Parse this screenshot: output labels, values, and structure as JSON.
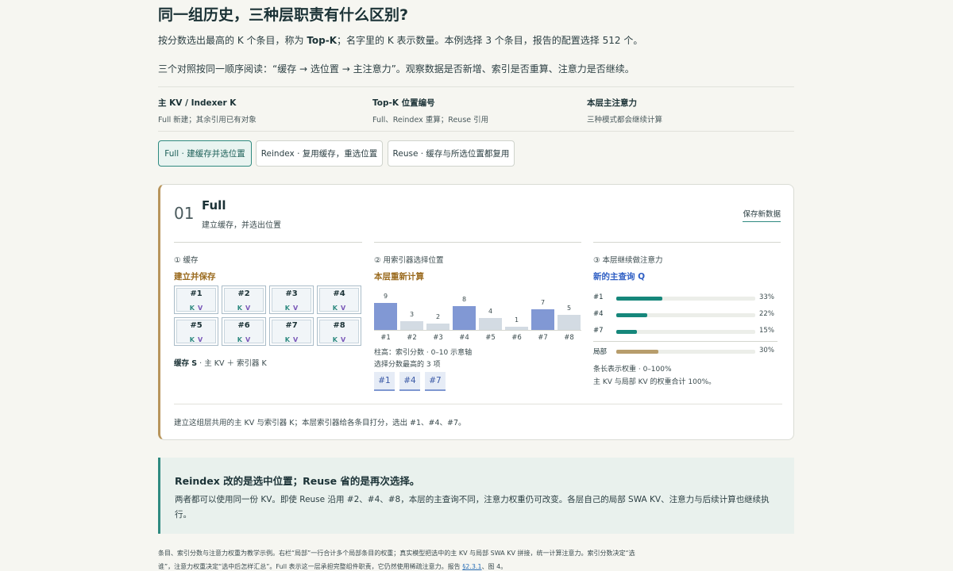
{
  "header": {
    "title": "同一组历史，三种层职责有什么区别?",
    "lead1_pre": "按分数选出最高的 K 个条目，称为 ",
    "lead1_bold": "Top-K",
    "lead1_post": "；名字里的 K 表示数量。本例选择 3 个条目，报告的配置选择 512 个。",
    "lead2": "三个对照按同一顺序阅读：“缓存 → 选位置 → 主注意力”。观察数据是否新增、索引是否重算、注意力是否继续。"
  },
  "legend": [
    {
      "title": "主 KV / Indexer K",
      "sub": "Full 新建；其余引用已有对象"
    },
    {
      "title": "Top-K 位置编号",
      "sub": "Full、Reindex 重算；Reuse 引用"
    },
    {
      "title": "本层主注意力",
      "sub": "三种模式都会继续计算"
    }
  ],
  "tabs": [
    {
      "label": "Full · 建缓存并选位置",
      "active": true
    },
    {
      "label": "Reindex · 复用缓存，重选位置",
      "active": false
    },
    {
      "label": "Reuse · 缓存与所选位置都复用",
      "active": false
    }
  ],
  "card": {
    "number": "01",
    "mode": "Full",
    "subtitle": "建立缓存，并选出位置",
    "save_link": "保存新数据",
    "col1": {
      "heading": "① 缓存",
      "title": "建立并保存",
      "title_color": "#9a6a1e",
      "cells": [
        {
          "id": "#1",
          "k": "K",
          "v": "V"
        },
        {
          "id": "#2",
          "k": "K",
          "v": "V"
        },
        {
          "id": "#3",
          "k": "K",
          "v": "V"
        },
        {
          "id": "#4",
          "k": "K",
          "v": "V"
        },
        {
          "id": "#5",
          "k": "K",
          "v": "V"
        },
        {
          "id": "#6",
          "k": "K",
          "v": "V"
        },
        {
          "id": "#7",
          "k": "K",
          "v": "V"
        },
        {
          "id": "#8",
          "k": "K",
          "v": "V"
        }
      ],
      "caption_bold": "缓存 S",
      "caption_rest": " · 主 KV ＋ 索引器 K"
    },
    "col2": {
      "heading": "② 用索引器选择位置",
      "title": "本层重新计算",
      "title_color": "#9a6a1e",
      "caption1": "柱高：索引分数 · 0–10 示意轴",
      "caption2": "选择分数最高的 3 项",
      "selected": [
        "#1",
        "#4",
        "#7"
      ]
    },
    "col3": {
      "heading": "③ 本层继续做注意力",
      "title": "新的主查询 Q",
      "title_color": "#2f5fc4",
      "caption1": "条长表示权重 · 0–100%",
      "caption2": "主 KV 与局部 KV 的权重合计 100%。"
    },
    "footer": "建立这组层共用的主 KV 与索引器 K；本层索引器给各条目打分，选出 #1、#4、#7。"
  },
  "chart_data": [
    {
      "type": "bar",
      "title": "本层重新计算",
      "categories": [
        "#1",
        "#2",
        "#3",
        "#4",
        "#5",
        "#6",
        "#7",
        "#8"
      ],
      "values": [
        9,
        3,
        2,
        8,
        4,
        1,
        7,
        5
      ],
      "ylim": [
        0,
        10
      ],
      "selected": [
        "#1",
        "#4",
        "#7"
      ],
      "colors": {
        "selected": "#8198d4",
        "other": "#d3dbe3"
      }
    },
    {
      "type": "bar",
      "title": "新的主查询 Q",
      "orientation": "horizontal",
      "categories": [
        "#1",
        "#4",
        "#7",
        "局部"
      ],
      "values": [
        33,
        22,
        15,
        30
      ],
      "value_labels": [
        "33%",
        "22%",
        "15%",
        "30%"
      ],
      "xlim": [
        0,
        100
      ],
      "colors": {
        "main": "#16877b",
        "local": "#b79d6c"
      }
    }
  ],
  "note": {
    "title": "Reindex 改的是选中位置；Reuse 省的是再次选择。",
    "body": "两者都可以使用同一份 KV。即使 Reuse 沿用 #2、#4、#8，本层的主查询不同，注意力权重仍可改变。各层自己的局部 SWA KV、注意力与后续计算也继续执行。"
  },
  "footnote": {
    "text": "条目、索引分数与注意力权重为教学示例。右栏“局部”一行合计多个局部条目的权重；真实模型把选中的主 KV 与局部 SWA KV 拼接，统一计算注意力。索引分数决定“选谁”，注意力权重决定“选中后怎样汇总”。Full 表示这一层承担完整组件职责，它仍然使用稀疏注意力。报告 ",
    "link": "§2.3.1",
    "tail": "、图 4。"
  }
}
